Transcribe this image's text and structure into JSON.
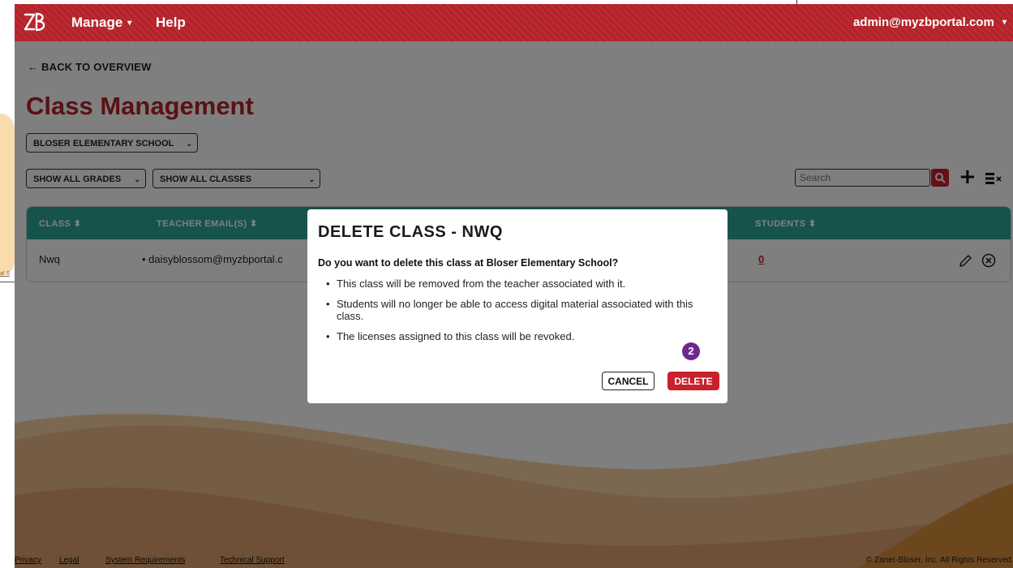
{
  "left_strip": {
    "link_text": "al S"
  },
  "nav": {
    "manage_label": "Manage",
    "manage_caret": "▾",
    "help_label": "Help",
    "user_email": "admin@myzbportal.com",
    "user_caret": "▾"
  },
  "page": {
    "back_label": "← BACK TO OVERVIEW",
    "title": "Class Management",
    "school_select": "BLOSER ELEMENTARY SCHOOL",
    "grades_select": "SHOW ALL GRADES",
    "classes_select": "SHOW ALL CLASSES",
    "select_chevron": "⌄"
  },
  "search": {
    "placeholder": "Search"
  },
  "table": {
    "headers": [
      "CLASS ⬍",
      "TEACHER EMAIL(S) ⬍",
      "STUDENTS ⬍"
    ],
    "rows": [
      {
        "class": "Nwq",
        "teacher": "• daisyblossom@myzbportal.c",
        "students": "0"
      }
    ]
  },
  "modal": {
    "title": "DELETE CLASS - NWQ",
    "question": "Do you want to delete this class at Bloser Elementary School?",
    "bullets": [
      "This class will be removed from the teacher associated with it.",
      "Students will no longer be able to access digital material associated with this class.",
      "The licenses assigned to this class will be revoked."
    ],
    "step_badge": "2",
    "cancel_label": "CANCEL",
    "delete_label": "DELETE"
  },
  "footer": {
    "links": [
      "Privacy",
      "Legal",
      "System Requirements",
      "Technical Support"
    ],
    "copyright": "© Zaner-Bloser, Inc. All Rights Reserved"
  },
  "colors": {
    "brand_red": "#b5222a",
    "table_header_teal": "#2ea69a",
    "delete_red": "#c8202c",
    "step_badge_purple": "#6b2a8c",
    "wave_peach": "#f6c98f",
    "wave_tan": "#e7b786",
    "wave_orange": "#d88e3d"
  },
  "icons": {
    "logo": "zb-logo",
    "search": "search-icon",
    "add": "plus-icon",
    "columns": "columns-toggle-icon",
    "edit": "pencil-icon",
    "remove": "circle-x-icon"
  }
}
